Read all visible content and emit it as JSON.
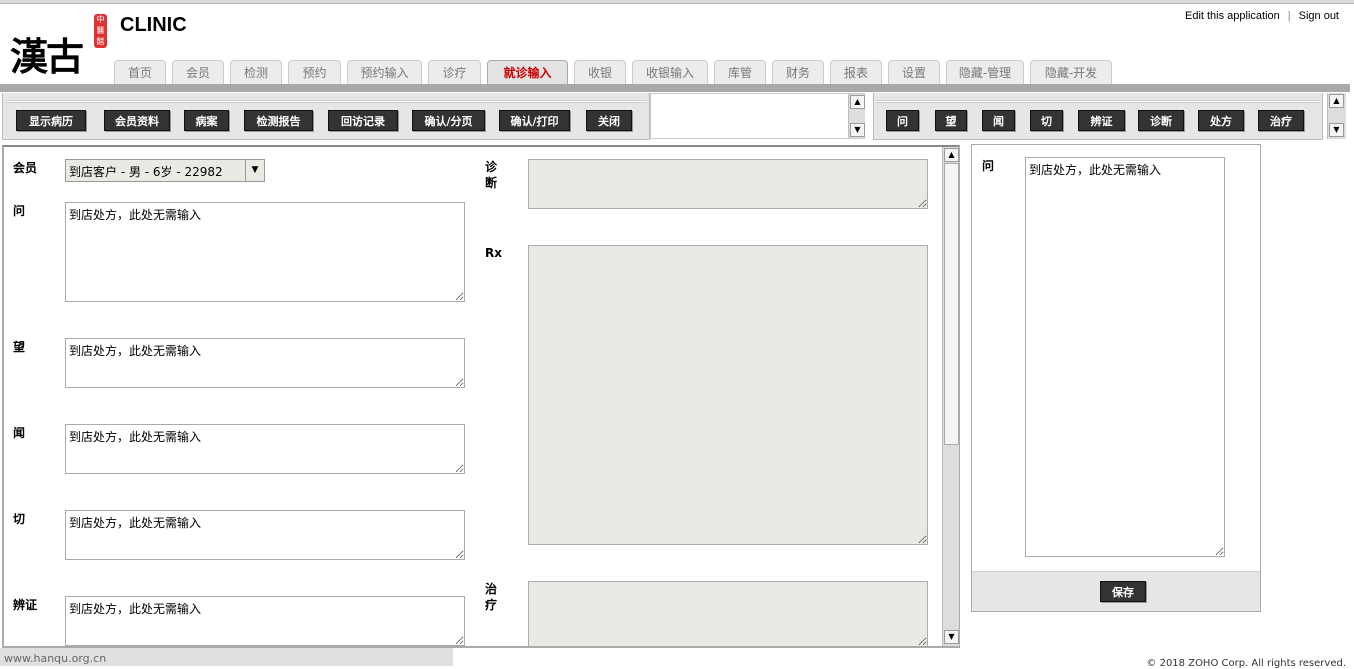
{
  "app": {
    "title": "CLINIC",
    "logo_text": "漢古",
    "logo_seal": "中醫館"
  },
  "top_links": {
    "edit": "Edit this application",
    "separator": "|",
    "signout": "Sign out"
  },
  "tabs": [
    {
      "label": "首页"
    },
    {
      "label": "会员"
    },
    {
      "label": "检测"
    },
    {
      "label": "预约"
    },
    {
      "label": "预约输入"
    },
    {
      "label": "诊疗"
    },
    {
      "label": "就诊输入",
      "active": true
    },
    {
      "label": "收银"
    },
    {
      "label": "收银输入"
    },
    {
      "label": "库管"
    },
    {
      "label": "财务"
    },
    {
      "label": "报表"
    },
    {
      "label": "设置"
    },
    {
      "label": "隐藏-管理"
    },
    {
      "label": "隐藏-开发"
    }
  ],
  "left_toolbar": [
    "显示病历",
    "会员资料",
    "病案",
    "检测报告",
    "回访记录",
    "确认/分页",
    "确认/打印",
    "关闭"
  ],
  "right_toolbar": [
    "问",
    "望",
    "闻",
    "切",
    "辨证",
    "诊断",
    "处方",
    "治疗"
  ],
  "form": {
    "member_label": "会员",
    "member_value": "到店客户 - 男 - 6岁 - 22982",
    "wen_label": "问",
    "wen_value": "到店处方，此处无需输入",
    "wang_label": "望",
    "wang_value": "到店处方，此处无需输入",
    "wen2_label": "闻",
    "wen2_value": "到店处方，此处无需输入",
    "qie_label": "切",
    "qie_value": "到店处方，此处无需输入",
    "bianzheng_label": "辨证",
    "bianzheng_value": "到店处方，此处无需输入",
    "diagnosis_label": "诊\n断",
    "diagnosis_value": "",
    "rx_label": "Rx",
    "rx_value": "",
    "treatment_label": "治\n疗",
    "treatment_value": ""
  },
  "side_panel": {
    "label": "问",
    "value": "到店处方，此处无需输入",
    "save": "保存"
  },
  "footer": {
    "url": "www.hanqu.org.cn",
    "copyright": "© 2018 ZOHO Corp. All rights reserved."
  }
}
